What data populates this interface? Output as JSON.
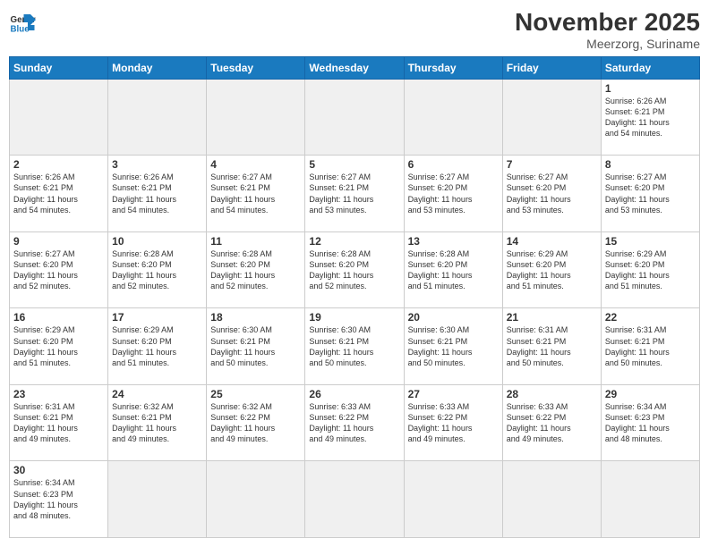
{
  "logo": {
    "text_general": "General",
    "text_blue": "Blue"
  },
  "header": {
    "month_year": "November 2025",
    "location": "Meerzorg, Suriname"
  },
  "weekdays": [
    "Sunday",
    "Monday",
    "Tuesday",
    "Wednesday",
    "Thursday",
    "Friday",
    "Saturday"
  ],
  "weeks": [
    [
      {
        "day": "",
        "info": ""
      },
      {
        "day": "",
        "info": ""
      },
      {
        "day": "",
        "info": ""
      },
      {
        "day": "",
        "info": ""
      },
      {
        "day": "",
        "info": ""
      },
      {
        "day": "",
        "info": ""
      },
      {
        "day": "1",
        "info": "Sunrise: 6:26 AM\nSunset: 6:21 PM\nDaylight: 11 hours\nand 54 minutes."
      }
    ],
    [
      {
        "day": "2",
        "info": "Sunrise: 6:26 AM\nSunset: 6:21 PM\nDaylight: 11 hours\nand 54 minutes."
      },
      {
        "day": "3",
        "info": "Sunrise: 6:26 AM\nSunset: 6:21 PM\nDaylight: 11 hours\nand 54 minutes."
      },
      {
        "day": "4",
        "info": "Sunrise: 6:27 AM\nSunset: 6:21 PM\nDaylight: 11 hours\nand 54 minutes."
      },
      {
        "day": "5",
        "info": "Sunrise: 6:27 AM\nSunset: 6:21 PM\nDaylight: 11 hours\nand 53 minutes."
      },
      {
        "day": "6",
        "info": "Sunrise: 6:27 AM\nSunset: 6:20 PM\nDaylight: 11 hours\nand 53 minutes."
      },
      {
        "day": "7",
        "info": "Sunrise: 6:27 AM\nSunset: 6:20 PM\nDaylight: 11 hours\nand 53 minutes."
      },
      {
        "day": "8",
        "info": "Sunrise: 6:27 AM\nSunset: 6:20 PM\nDaylight: 11 hours\nand 53 minutes."
      }
    ],
    [
      {
        "day": "9",
        "info": "Sunrise: 6:27 AM\nSunset: 6:20 PM\nDaylight: 11 hours\nand 52 minutes."
      },
      {
        "day": "10",
        "info": "Sunrise: 6:28 AM\nSunset: 6:20 PM\nDaylight: 11 hours\nand 52 minutes."
      },
      {
        "day": "11",
        "info": "Sunrise: 6:28 AM\nSunset: 6:20 PM\nDaylight: 11 hours\nand 52 minutes."
      },
      {
        "day": "12",
        "info": "Sunrise: 6:28 AM\nSunset: 6:20 PM\nDaylight: 11 hours\nand 52 minutes."
      },
      {
        "day": "13",
        "info": "Sunrise: 6:28 AM\nSunset: 6:20 PM\nDaylight: 11 hours\nand 51 minutes."
      },
      {
        "day": "14",
        "info": "Sunrise: 6:29 AM\nSunset: 6:20 PM\nDaylight: 11 hours\nand 51 minutes."
      },
      {
        "day": "15",
        "info": "Sunrise: 6:29 AM\nSunset: 6:20 PM\nDaylight: 11 hours\nand 51 minutes."
      }
    ],
    [
      {
        "day": "16",
        "info": "Sunrise: 6:29 AM\nSunset: 6:20 PM\nDaylight: 11 hours\nand 51 minutes."
      },
      {
        "day": "17",
        "info": "Sunrise: 6:29 AM\nSunset: 6:20 PM\nDaylight: 11 hours\nand 51 minutes."
      },
      {
        "day": "18",
        "info": "Sunrise: 6:30 AM\nSunset: 6:21 PM\nDaylight: 11 hours\nand 50 minutes."
      },
      {
        "day": "19",
        "info": "Sunrise: 6:30 AM\nSunset: 6:21 PM\nDaylight: 11 hours\nand 50 minutes."
      },
      {
        "day": "20",
        "info": "Sunrise: 6:30 AM\nSunset: 6:21 PM\nDaylight: 11 hours\nand 50 minutes."
      },
      {
        "day": "21",
        "info": "Sunrise: 6:31 AM\nSunset: 6:21 PM\nDaylight: 11 hours\nand 50 minutes."
      },
      {
        "day": "22",
        "info": "Sunrise: 6:31 AM\nSunset: 6:21 PM\nDaylight: 11 hours\nand 50 minutes."
      }
    ],
    [
      {
        "day": "23",
        "info": "Sunrise: 6:31 AM\nSunset: 6:21 PM\nDaylight: 11 hours\nand 49 minutes."
      },
      {
        "day": "24",
        "info": "Sunrise: 6:32 AM\nSunset: 6:21 PM\nDaylight: 11 hours\nand 49 minutes."
      },
      {
        "day": "25",
        "info": "Sunrise: 6:32 AM\nSunset: 6:22 PM\nDaylight: 11 hours\nand 49 minutes."
      },
      {
        "day": "26",
        "info": "Sunrise: 6:33 AM\nSunset: 6:22 PM\nDaylight: 11 hours\nand 49 minutes."
      },
      {
        "day": "27",
        "info": "Sunrise: 6:33 AM\nSunset: 6:22 PM\nDaylight: 11 hours\nand 49 minutes."
      },
      {
        "day": "28",
        "info": "Sunrise: 6:33 AM\nSunset: 6:22 PM\nDaylight: 11 hours\nand 49 minutes."
      },
      {
        "day": "29",
        "info": "Sunrise: 6:34 AM\nSunset: 6:23 PM\nDaylight: 11 hours\nand 48 minutes."
      }
    ],
    [
      {
        "day": "30",
        "info": "Sunrise: 6:34 AM\nSunset: 6:23 PM\nDaylight: 11 hours\nand 48 minutes."
      },
      {
        "day": "",
        "info": ""
      },
      {
        "day": "",
        "info": ""
      },
      {
        "day": "",
        "info": ""
      },
      {
        "day": "",
        "info": ""
      },
      {
        "day": "",
        "info": ""
      },
      {
        "day": "",
        "info": ""
      }
    ]
  ]
}
